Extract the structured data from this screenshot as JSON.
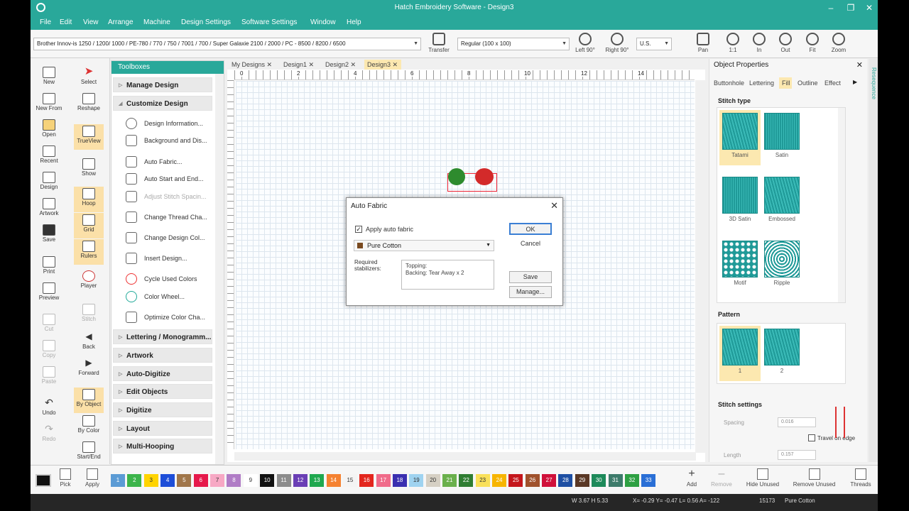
{
  "app": {
    "title": "Hatch Embroidery Software - Design3",
    "colors": {
      "accent": "#29a89a",
      "selected": "#fce8b0",
      "stitch": "#1f9a98"
    }
  },
  "menu": [
    "File",
    "Edit",
    "View",
    "Arrange",
    "Machine",
    "Design Settings",
    "Software Settings",
    "Window",
    "Help"
  ],
  "toolbar": {
    "machine": "Brother Innov-is 1250 / 1200/ 1000 / PE-780 / 770 / 750 / 7001 / 700 / Super Galaxie 2100 / 2000 / PC - 8500 / 8200 / 6500",
    "transfer": "Transfer",
    "hoop": "Regular (100 x 100)",
    "left90": "Left 90°",
    "right90": "Right 90°",
    "units": "U.S.",
    "pan": "Pan",
    "zoom11": "1:1",
    "zoomin": "In",
    "zoomout": "Out",
    "fit": "Fit",
    "zoom": "Zoom"
  },
  "lefttools": {
    "col1": [
      "New",
      "New From",
      "Open",
      "Recent",
      "Design",
      "Artwork",
      "Save",
      "Print",
      "Preview",
      "Cut",
      "Copy",
      "Paste",
      "Undo",
      "Redo"
    ],
    "col2": [
      "Select",
      "Reshape",
      "TrueView",
      "Show",
      "Hoop",
      "Grid",
      "Rulers",
      "Player",
      "Stitch",
      "Back",
      "Forward",
      "By Object",
      "By Color",
      "Start/End"
    ]
  },
  "toolbox": {
    "title": "Toolboxes",
    "sections_top": [
      "Manage Design",
      "Customize Design"
    ],
    "items": [
      "Design Information...",
      "Background and Dis...",
      "Auto Fabric...",
      "Auto Start and End...",
      "Adjust Stitch Spacin...",
      "Change Thread Cha...",
      "Change Design Col...",
      "Insert Design...",
      "Cycle Used Colors",
      "Color Wheel...",
      "Optimize Color Cha..."
    ],
    "sections_bottom": [
      "Lettering / Monogramm...",
      "Artwork",
      "Auto-Digitize",
      "Edit Objects",
      "Digitize",
      "Layout",
      "Multi-Hooping"
    ]
  },
  "doctabs": [
    "My Designs",
    "Design1",
    "Design2",
    "Design3"
  ],
  "ruler": [
    "0",
    "2",
    "4",
    "6",
    "8",
    "10",
    "12",
    "14"
  ],
  "dialog": {
    "title": "Auto Fabric",
    "apply_label": "Apply auto fabric",
    "fabric": "Pure Cotton",
    "stabilizers_label": "Required stabilizers:",
    "topping": "Topping:",
    "backing": "Backing: Tear Away x 2",
    "ok": "OK",
    "cancel": "Cancel",
    "save": "Save",
    "manage": "Manage..."
  },
  "props": {
    "title": "Object Properties",
    "tabs": [
      "Buttonhole",
      "Lettering",
      "Fill",
      "Outline",
      "Effect"
    ],
    "stitch_type_label": "Stitch type",
    "stitch_types": [
      "Tatami",
      "Satin",
      "3D Satin",
      "Embossed",
      "Motif",
      "Ripple"
    ],
    "pattern_label": "Pattern",
    "patterns": [
      "1",
      "2"
    ],
    "settings_label": "Stitch settings",
    "spacing_label": "Spacing",
    "spacing_value": "0.016",
    "travel_label": "Travel on edge",
    "length_label": "Length",
    "length_value": "0.157",
    "side_tab": "Resequence"
  },
  "palette": {
    "chips": [
      {
        "n": "1",
        "c": "#5b9bd5"
      },
      {
        "n": "2",
        "c": "#3cb44b"
      },
      {
        "n": "3",
        "c": "#ffd400"
      },
      {
        "n": "4",
        "c": "#1d4ed8"
      },
      {
        "n": "5",
        "c": "#a0764a"
      },
      {
        "n": "6",
        "c": "#e6194b"
      },
      {
        "n": "7",
        "c": "#f7a8c4"
      },
      {
        "n": "8",
        "c": "#b07cc6"
      },
      {
        "n": "9",
        "c": "#ffffff"
      },
      {
        "n": "10",
        "c": "#111111"
      },
      {
        "n": "11",
        "c": "#8c8c8c"
      },
      {
        "n": "12",
        "c": "#6a3fb5"
      },
      {
        "n": "13",
        "c": "#1fa84f"
      },
      {
        "n": "14",
        "c": "#f58231"
      },
      {
        "n": "15",
        "c": "#f4f4f4"
      },
      {
        "n": "16",
        "c": "#e3261d"
      },
      {
        "n": "17",
        "c": "#f06b8a"
      },
      {
        "n": "18",
        "c": "#3a2fb0"
      },
      {
        "n": "19",
        "c": "#9fd3f0"
      },
      {
        "n": "20",
        "c": "#d6d0c4"
      },
      {
        "n": "21",
        "c": "#6ab04c"
      },
      {
        "n": "22",
        "c": "#2f7d32"
      },
      {
        "n": "23",
        "c": "#f9e05a"
      },
      {
        "n": "24",
        "c": "#f7b500"
      },
      {
        "n": "25",
        "c": "#c4161c"
      },
      {
        "n": "26",
        "c": "#a0522d"
      },
      {
        "n": "27",
        "c": "#d0103a"
      },
      {
        "n": "28",
        "c": "#1e4fa3"
      },
      {
        "n": "29",
        "c": "#5a3825"
      },
      {
        "n": "30",
        "c": "#1d8a5a"
      },
      {
        "n": "31",
        "c": "#3d7b6b"
      },
      {
        "n": "32",
        "c": "#2ea043"
      },
      {
        "n": "33",
        "c": "#2a6fd6"
      }
    ],
    "pick": "Pick",
    "apply": "Apply",
    "add": "Add",
    "remove": "Remove",
    "hide_unused": "Hide Unused",
    "remove_unused": "Remove Unused",
    "threads": "Threads"
  },
  "status": {
    "size": "W 3.67 H 5.33",
    "coords": "X= -0.29 Y= -0.47 L= 0.56 A= -122",
    "stitches": "15173",
    "fabric": "Pure Cotton"
  }
}
